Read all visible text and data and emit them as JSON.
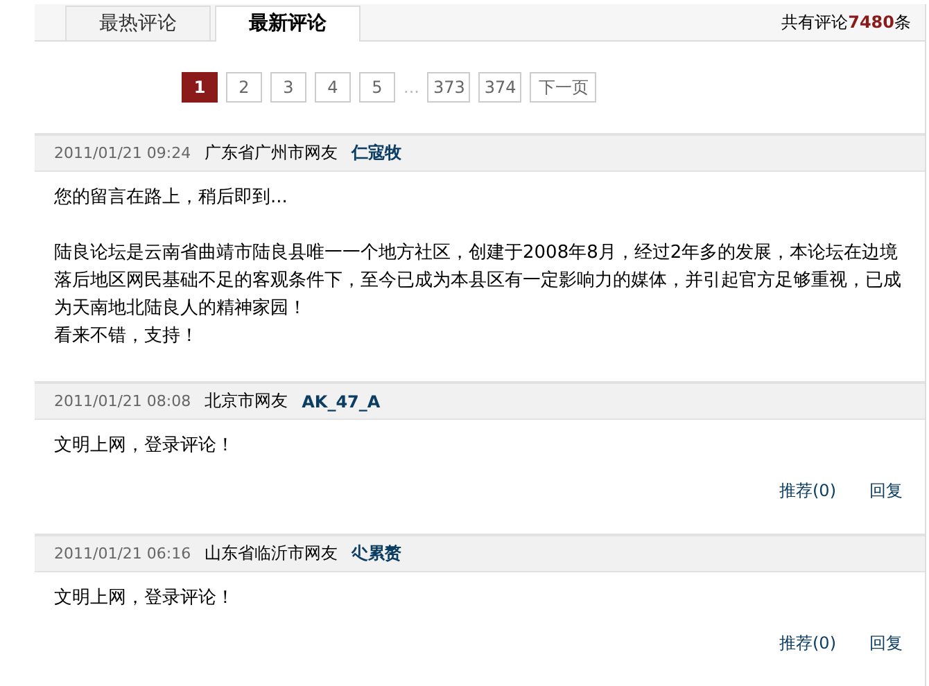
{
  "tabs": [
    {
      "label": "最热评论",
      "selected": false
    },
    {
      "label": "最新评论",
      "selected": true
    }
  ],
  "total": {
    "prefix": "共有评论",
    "count": "7480",
    "suffix": "条"
  },
  "pagination": {
    "pages": [
      {
        "label": "1",
        "selected": true
      },
      {
        "label": "2",
        "selected": false
      },
      {
        "label": "3",
        "selected": false
      },
      {
        "label": "4",
        "selected": false
      },
      {
        "label": "5",
        "selected": false
      }
    ],
    "ellipsis": "...",
    "last_pages": [
      {
        "label": "373",
        "selected": false
      },
      {
        "label": "374",
        "selected": false
      }
    ],
    "next": "下一页"
  },
  "comments": [
    {
      "time": "2011/01/21 09:24",
      "location": "广东省广州市网友",
      "user": "仁寇牧",
      "blocks": [
        [
          "您的留言在路上，稍后即到..."
        ],
        [
          "陆良论坛是云南省曲靖市陆良县唯一一个地方社区，创建于2008年8月，经过2年多的发展，本论坛在边境落后地区网民基础不足的客观条件下，至今已成为本县区有一定影响力的媒体，并引起官方足够重视，已成为天南地北陆良人的精神家园！",
          "看来不错，支持！"
        ]
      ]
    },
    {
      "time": "2011/01/21 08:08",
      "location": "北京市网友",
      "user": "AK_47_A",
      "blocks": [
        [
          "文明上网，登录评论！"
        ]
      ],
      "recommend": "推荐(0)",
      "reply": "回复"
    },
    {
      "time": "2011/01/21 06:16",
      "location": "山东省临沂市网友",
      "user": "尐累赘",
      "blocks": [
        [
          "文明上网，登录评论！"
        ]
      ],
      "recommend": "推荐(0)",
      "reply": "回复"
    }
  ]
}
